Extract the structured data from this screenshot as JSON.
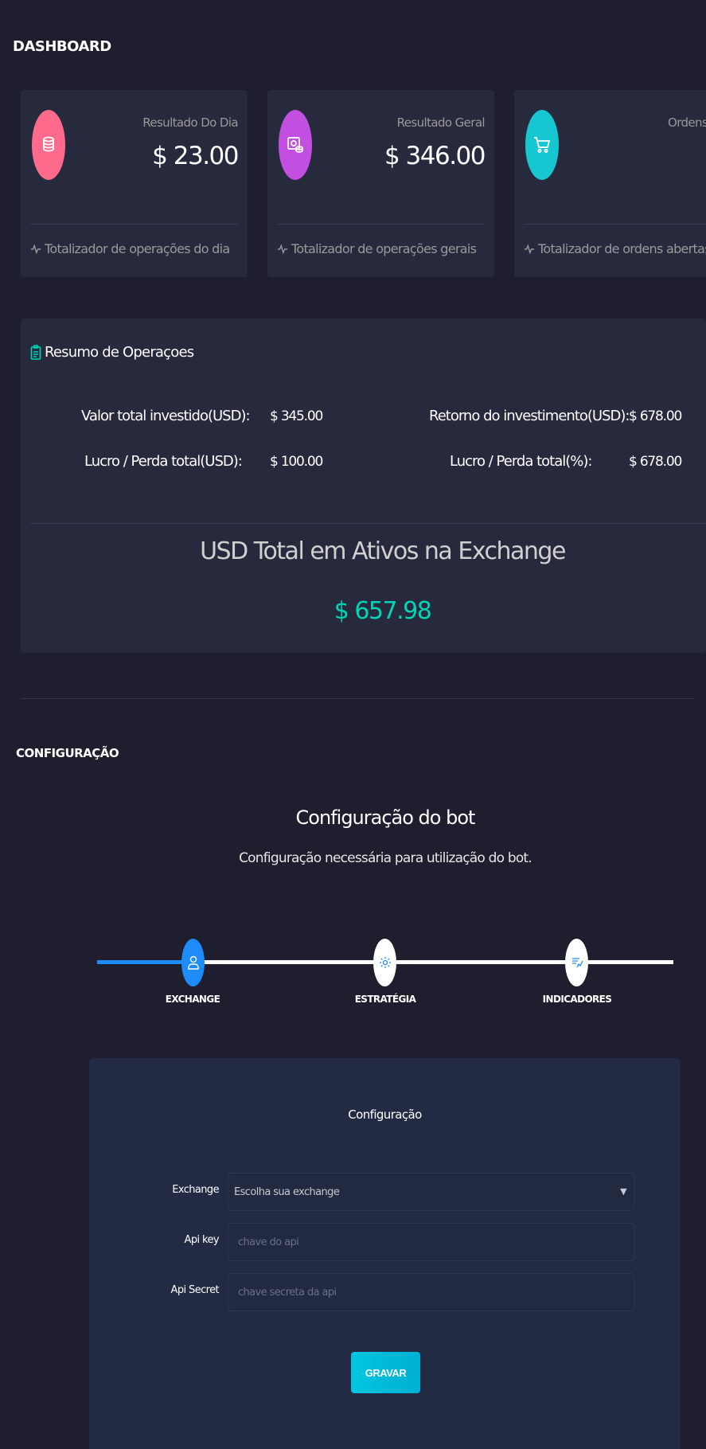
{
  "dashboard": {
    "title": "DASHBOARD",
    "cards": [
      {
        "label": "Resultado Do Dia",
        "value": "$ 23.00",
        "footer": "Totalizador de operações do dia",
        "icon": "coins-icon",
        "color": "#fd5d93"
      },
      {
        "label": "Resultado Geral",
        "value": "$ 346.00",
        "footer": "Totalizador de operações gerais",
        "icon": "safe-coins-icon",
        "color": "#ba54f5"
      },
      {
        "label": "Ordens",
        "value": "",
        "footer": "Totalizador de ordens abertas",
        "icon": "cart-icon",
        "color": "#00d6b4"
      }
    ]
  },
  "summary": {
    "title": "Resumo de Operaçoes",
    "total_invested_label": "Valor total investido(USD):",
    "total_invested_value": "$ 345.00",
    "roi_label": "Retorno do investimento(USD):",
    "roi_value": "$ 678.00",
    "pl_usd_label": "Lucro / Perda total(USD):",
    "pl_usd_value": "$ 100.00",
    "pl_pct_label": "Lucro / Perda total(%):",
    "pl_pct_value": "$ 678.00",
    "usd_total_title": "USD Total em Ativos na Exchange",
    "usd_total_value": "$ 657.98"
  },
  "config": {
    "section_title": "CONFIGURAÇÃO",
    "bot_title": "Configuração do bot",
    "bot_subtitle": "Configuração necessária para utilização do bot.",
    "steps": [
      {
        "label": "EXCHANGE",
        "icon": "user-icon",
        "active": true
      },
      {
        "label": "ESTRATÉGIA",
        "icon": "gear-icon",
        "active": false
      },
      {
        "label": "INDICADORES",
        "icon": "indicators-icon",
        "active": false
      }
    ],
    "form": {
      "title": "Configuração",
      "exchange_label": "Exchange",
      "exchange_value": "Escolha sua exchange",
      "api_key_label": "Api key",
      "api_key_placeholder": "chave do api",
      "api_secret_label": "Api Secret",
      "api_secret_placeholder": "chave secreta da api",
      "save_label": "GRAVAR"
    }
  },
  "colors": {
    "accent_blue": "#1d8cf8",
    "accent_green": "#00d6b4",
    "card_bg": "#27293d",
    "page_bg": "#1f1e2e"
  }
}
